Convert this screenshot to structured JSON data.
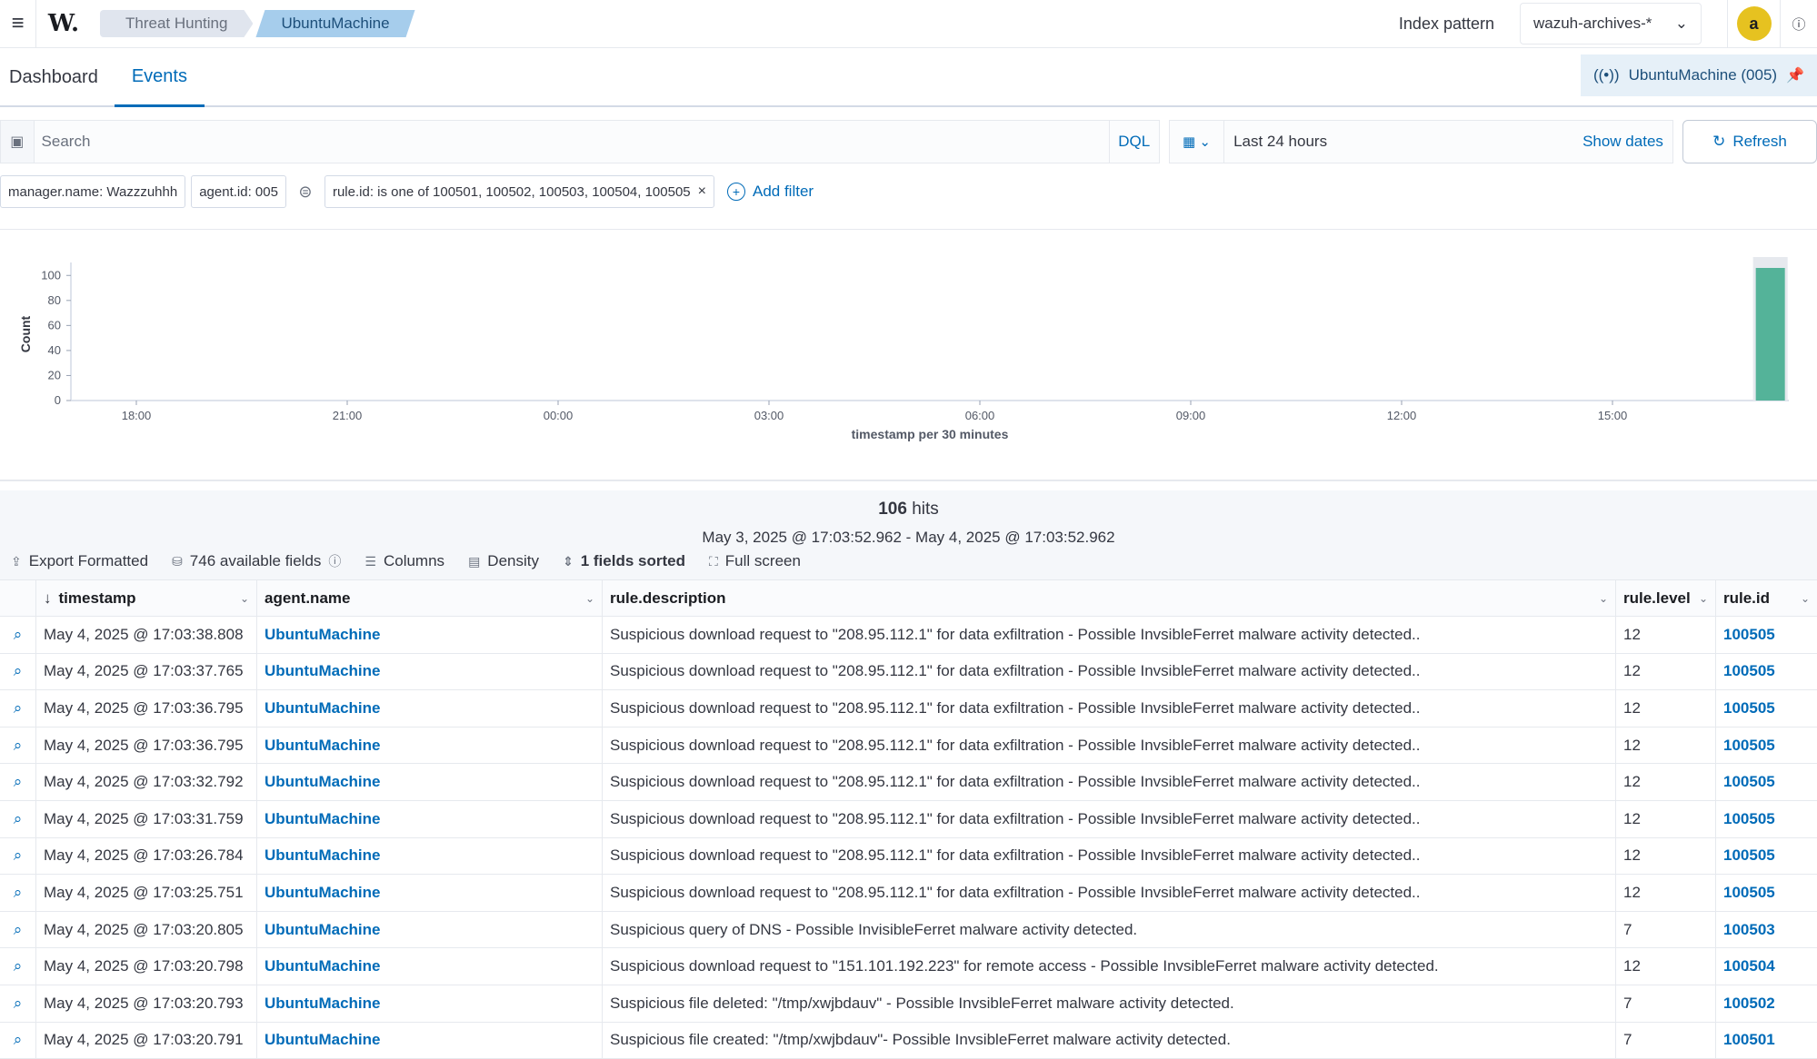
{
  "header": {
    "logo": "W.",
    "breadcrumbs": [
      "Threat Hunting",
      "UbuntuMachine"
    ],
    "index_label": "Index pattern",
    "index_value": "wazuh-archives-*",
    "avatar": "a",
    "help": "?"
  },
  "tabs": [
    "Dashboard",
    "Events"
  ],
  "agent_pill": "UbuntuMachine (005)",
  "query": {
    "placeholder": "Search",
    "dql": "DQL",
    "date_range": "Last 24 hours",
    "show_dates": "Show dates",
    "refresh": "Refresh"
  },
  "filters": {
    "items": [
      "manager.name: Wazzzuhhh",
      "agent.id: 005",
      "rule.id: is one of 100501, 100502, 100503, 100504, 100505"
    ],
    "add": "Add filter"
  },
  "chart_data": {
    "type": "bar",
    "ylabel": "Count",
    "xlabel": "timestamp per 30 minutes",
    "yticks": [
      0,
      20,
      40,
      60,
      80,
      100
    ],
    "ylim": [
      0,
      106
    ],
    "xticks": [
      "18:00",
      "21:00",
      "00:00",
      "03:00",
      "06:00",
      "09:00",
      "12:00",
      "15:00"
    ],
    "values": [
      {
        "x": "17:00",
        "y": 106
      }
    ],
    "color": "#54b399",
    "grid": false
  },
  "hits": {
    "count": "106",
    "label": "hits",
    "range": "May 3, 2025 @ 17:03:52.962 - May 4, 2025 @ 17:03:52.962"
  },
  "tools": [
    "Export Formatted",
    "746 available fields",
    "Columns",
    "Density",
    "1 fields sorted",
    "Full screen"
  ],
  "table": {
    "columns": [
      "timestamp",
      "agent.name",
      "rule.description",
      "rule.level",
      "rule.id"
    ],
    "rows": [
      [
        "May 4, 2025 @ 17:03:38.808",
        "UbuntuMachine",
        "Suspicious download request to \"208.95.112.1\" for data exfiltration - Possible InvsibleFerret malware activity detected..",
        "12",
        "100505"
      ],
      [
        "May 4, 2025 @ 17:03:37.765",
        "UbuntuMachine",
        "Suspicious download request to \"208.95.112.1\" for data exfiltration - Possible InvsibleFerret malware activity detected..",
        "12",
        "100505"
      ],
      [
        "May 4, 2025 @ 17:03:36.795",
        "UbuntuMachine",
        "Suspicious download request to \"208.95.112.1\" for data exfiltration - Possible InvsibleFerret malware activity detected..",
        "12",
        "100505"
      ],
      [
        "May 4, 2025 @ 17:03:36.795",
        "UbuntuMachine",
        "Suspicious download request to \"208.95.112.1\" for data exfiltration - Possible InvsibleFerret malware activity detected..",
        "12",
        "100505"
      ],
      [
        "May 4, 2025 @ 17:03:32.792",
        "UbuntuMachine",
        "Suspicious download request to \"208.95.112.1\" for data exfiltration - Possible InvsibleFerret malware activity detected..",
        "12",
        "100505"
      ],
      [
        "May 4, 2025 @ 17:03:31.759",
        "UbuntuMachine",
        "Suspicious download request to \"208.95.112.1\" for data exfiltration - Possible InvsibleFerret malware activity detected..",
        "12",
        "100505"
      ],
      [
        "May 4, 2025 @ 17:03:26.784",
        "UbuntuMachine",
        "Suspicious download request to \"208.95.112.1\" for data exfiltration - Possible InvsibleFerret malware activity detected..",
        "12",
        "100505"
      ],
      [
        "May 4, 2025 @ 17:03:25.751",
        "UbuntuMachine",
        "Suspicious download request to \"208.95.112.1\" for data exfiltration - Possible InvsibleFerret malware activity detected..",
        "12",
        "100505"
      ],
      [
        "May 4, 2025 @ 17:03:20.805",
        "UbuntuMachine",
        "Suspicious query of DNS - Possible InvisibleFerret malware activity detected.",
        "7",
        "100503"
      ],
      [
        "May 4, 2025 @ 17:03:20.798",
        "UbuntuMachine",
        "Suspicious download request to \"151.101.192.223\" for remote access - Possible InvsibleFerret malware activity detected.",
        "12",
        "100504"
      ],
      [
        "May 4, 2025 @ 17:03:20.793",
        "UbuntuMachine",
        "Suspicious file deleted: \"/tmp/xwjbdauv\" - Possible InvsibleFerret malware activity detected.",
        "7",
        "100502"
      ],
      [
        "May 4, 2025 @ 17:03:20.791",
        "UbuntuMachine",
        "Suspicious file created: \"/tmp/xwjbdauv\"- Possible InvsibleFerret malware activity detected.",
        "7",
        "100501"
      ]
    ]
  }
}
